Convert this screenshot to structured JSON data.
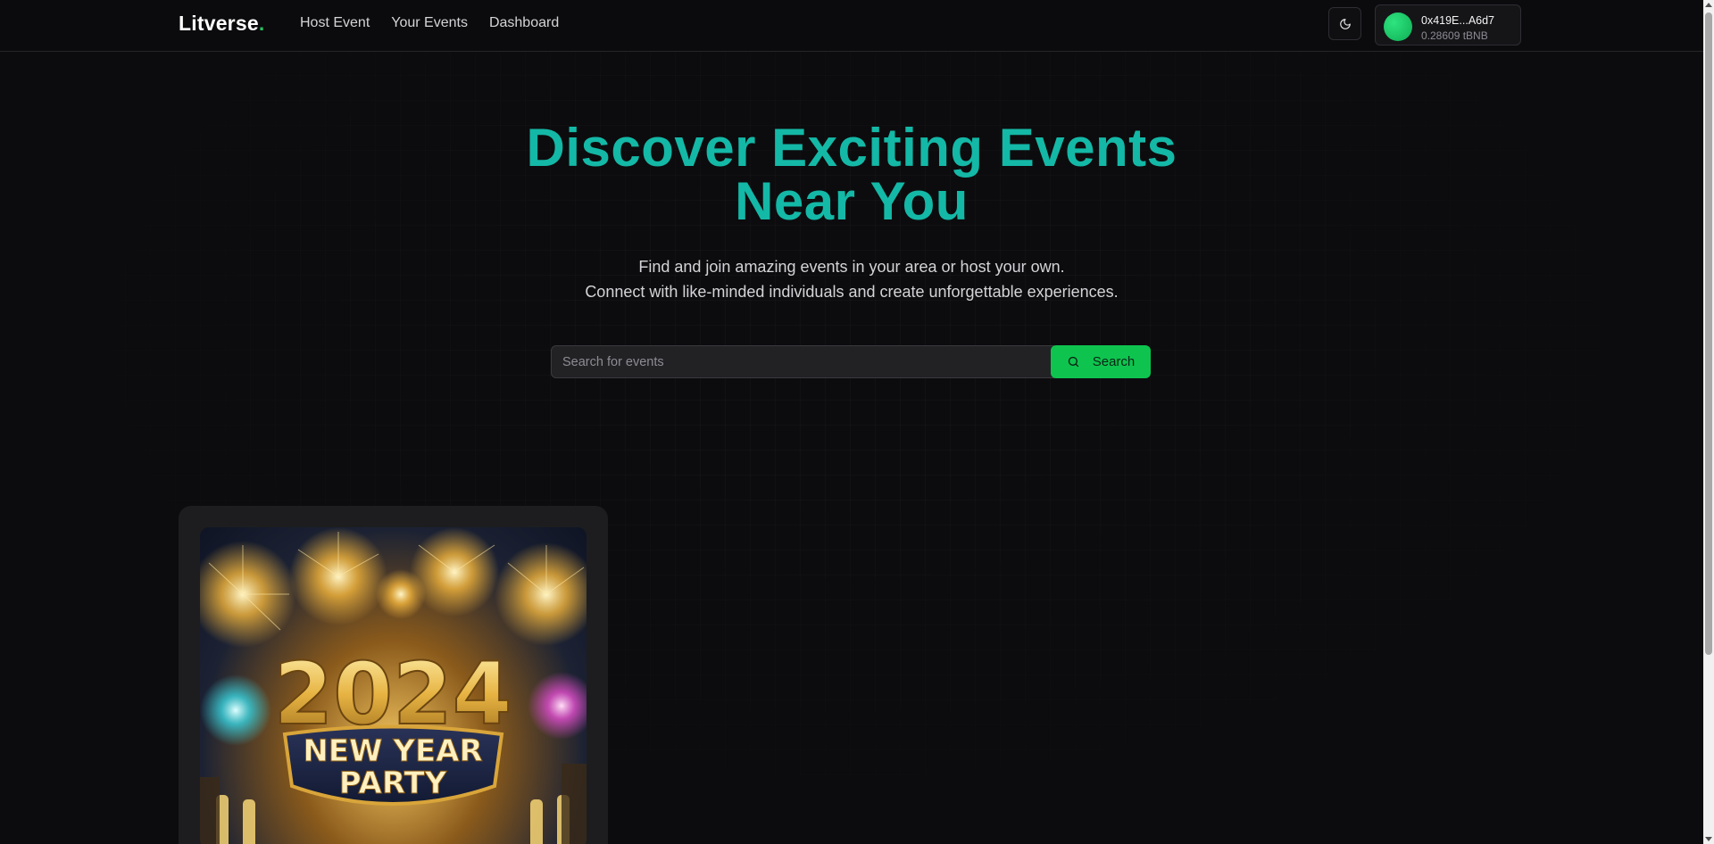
{
  "header": {
    "logo_text": "Litverse",
    "logo_dot": ".",
    "nav": [
      {
        "label": "Host Event"
      },
      {
        "label": "Your Events"
      },
      {
        "label": "Dashboard"
      }
    ],
    "theme_icon": "moon-icon",
    "wallet": {
      "address": "0x419E...A6d7",
      "balance": "0.28609 tBNB"
    }
  },
  "hero": {
    "title_line1": "Discover Exciting Events",
    "title_line2": "Near You",
    "subtitle_line1": "Find and join amazing events in your area or host your own.",
    "subtitle_line2": "Connect with like-minded individuals and create unforgettable experiences."
  },
  "search": {
    "placeholder": "Search for events",
    "value": "",
    "button_label": "Search",
    "icon": "search-icon"
  },
  "events": [
    {
      "image_year": "2024",
      "image_line1": "NEW YEAR",
      "image_line2": "PARTY"
    }
  ],
  "colors": {
    "accent_title": "#14b8a6",
    "accent_green": "#0ec44f",
    "background": "#0c0c0e"
  }
}
